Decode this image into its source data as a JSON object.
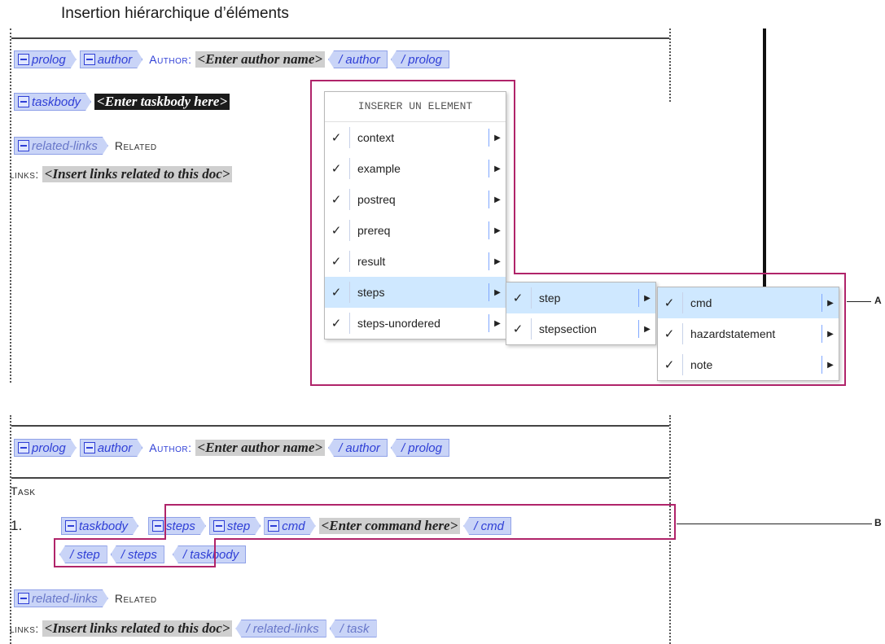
{
  "title": "Insertion hiérarchique d’éléments",
  "top_doc": {
    "prolog": "prolog",
    "author": "author",
    "author_label": "Author:",
    "author_ph": "<Enter author name>",
    "close_author": "/ author",
    "close_prolog": "/ prolog",
    "taskbody": "taskbody",
    "taskbody_ph": "<Enter taskbody here>",
    "related_links": "related-links",
    "related_label": "Related",
    "links_label": "links:",
    "links_ph": "<Insert links related to this doc>"
  },
  "menu": {
    "header": "INSERER UN ELEMENT",
    "items": [
      "context",
      "example",
      "postreq",
      "prereq",
      "result",
      "steps",
      "steps-unordered"
    ],
    "selected": "steps"
  },
  "submenu1": {
    "items": [
      "step",
      "stepsection"
    ],
    "selected": "step"
  },
  "submenu2": {
    "items": [
      "cmd",
      "hazardstatement",
      "note"
    ],
    "selected": "cmd"
  },
  "check_mark": "✓",
  "arrow": "▶",
  "bottom_doc": {
    "prolog": "prolog",
    "author": "author",
    "author_label": "Author:",
    "author_ph": "<Enter author name>",
    "close_author": "/ author",
    "close_prolog": "/ prolog",
    "task_label": "Task",
    "step_number": "1.",
    "taskbody": "taskbody",
    "steps": "steps",
    "step": "step",
    "cmd": "cmd",
    "cmd_ph": "<Enter command here>",
    "close_cmd": "/ cmd",
    "close_step": "/ step",
    "close_steps": "/ steps",
    "close_taskbody": "/ taskbody",
    "related_links": "related-links",
    "related_label": "Related",
    "links_label": "links:",
    "links_ph": "<Insert links related to this doc>",
    "close_related": "/ related-links",
    "close_task": "/ task"
  },
  "callouts": {
    "a": "A",
    "b": "B"
  },
  "colors": {
    "tag_bg": "#c9d4f7",
    "tag_text": "#2f3fd6",
    "highlight_box": "#b0246a",
    "menu_hl": "#cfe8ff"
  }
}
